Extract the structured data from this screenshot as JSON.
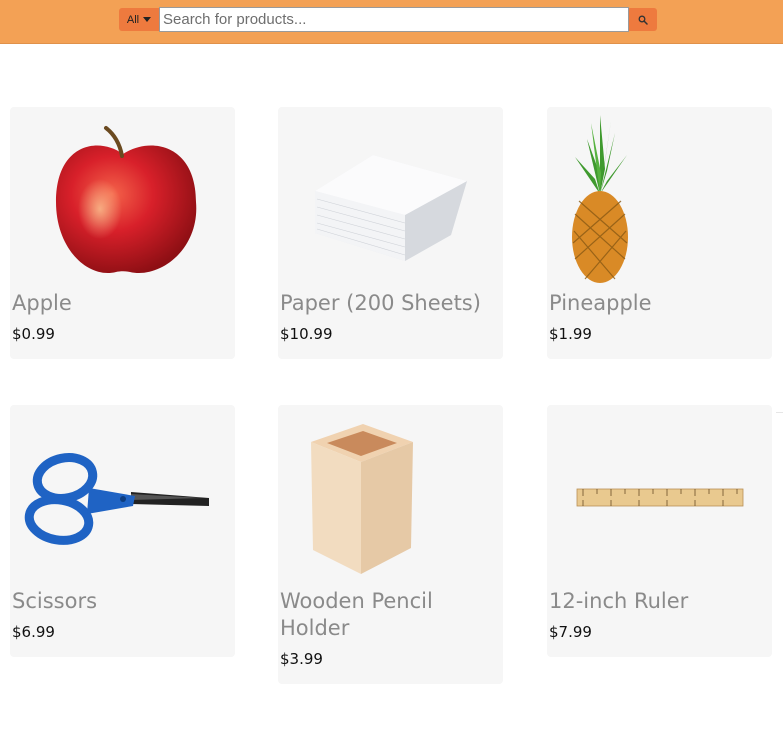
{
  "header": {
    "category_label": "All",
    "search_placeholder": "Search for products...",
    "search_value": "",
    "accent_color": "#f3a155",
    "button_color": "#ee7a3e",
    "icons": {
      "category": "caret-down-icon",
      "search": "search-icon"
    }
  },
  "products": [
    {
      "name": "Apple",
      "price": "$0.99",
      "image": "apple-image"
    },
    {
      "name": "Paper (200 Sheets)",
      "price": "$10.99",
      "image": "paper-stack-image"
    },
    {
      "name": "Pineapple",
      "price": "$1.99",
      "image": "pineapple-image"
    },
    {
      "name": "Scissors",
      "price": "$6.99",
      "image": "scissors-image"
    },
    {
      "name": "Wooden Pencil Holder",
      "price": "$3.99",
      "image": "pencil-holder-image"
    },
    {
      "name": "12-inch Ruler",
      "price": "$7.99",
      "image": "ruler-image"
    }
  ]
}
